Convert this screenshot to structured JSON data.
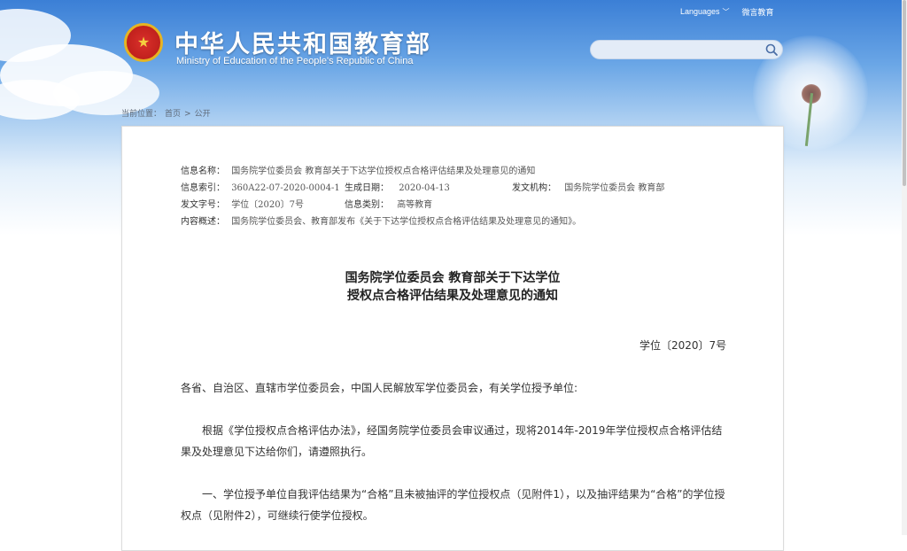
{
  "header": {
    "site_title": "中华人民共和国教育部",
    "site_subtitle": "Ministry of Education of the People's Republic of China",
    "top_links": {
      "languages": "Languages",
      "wechat": "微言教育"
    },
    "search": {
      "placeholder": ""
    },
    "colors": {
      "sky": "#3b7fd6",
      "emblem_red": "#c62420",
      "emblem_gold": "#e6b422"
    },
    "icons": {
      "emblem": "national-emblem-icon",
      "search": "search-icon",
      "languages": "chevron-down-icon"
    }
  },
  "breadcrumb": {
    "label": "当前位置：",
    "items": [
      "首页",
      "公开"
    ],
    "separator": ">"
  },
  "meta": {
    "name_label": "信息名称：",
    "name_value": "国务院学位委员会 教育部关于下达学位授权点合格评估结果及处理意见的通知",
    "index_label": "信息索引：",
    "index_value": "360A22-07-2020-0004-1",
    "date_label": "生成日期：",
    "date_value": "2020-04-13",
    "issuer_label": "发文机构：",
    "issuer_value": "国务院学位委员会 教育部",
    "doc_no_label": "发文字号：",
    "doc_no_value": "学位〔2020〕7号",
    "category_label": "信息类别：",
    "category_value": "高等教育",
    "summary_label": "内容概述：",
    "summary_value": "国务院学位委员会、教育部发布《关于下达学位授权点合格评估结果及处理意见的通知》。"
  },
  "document": {
    "title_line1": "国务院学位委员会 教育部关于下达学位",
    "title_line2": "授权点合格评估结果及处理意见的通知",
    "doc_number": "学位〔2020〕7号",
    "salutation": "各省、自治区、直辖市学位委员会，中国人民解放军学位委员会，有关学位授予单位:",
    "para1": "根据《学位授权点合格评估办法》，经国务院学位委员会审议通过，现将2014年-2019年学位授权点合格评估结果及处理意见下达给你们，请遵照执行。",
    "para2": "一、学位授予单位自我评估结果为“合格”且未被抽评的学位授权点（见附件1），以及抽评结果为“合格”的学位授权点（见附件2），可继续行使学位授权。"
  }
}
